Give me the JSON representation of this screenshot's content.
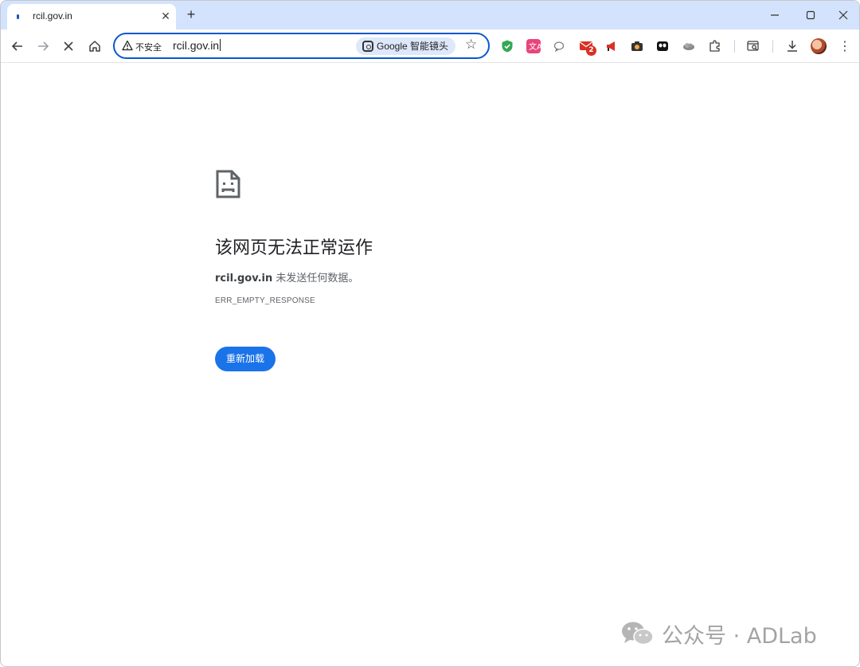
{
  "tab": {
    "title": "rcil.gov.in",
    "close_glyph": "✕",
    "new_tab_glyph": "+"
  },
  "window_controls": {
    "minimize": "—",
    "maximize": "☐",
    "close": "✕"
  },
  "toolbar": {
    "back_glyph": "←",
    "forward_glyph": "→",
    "stop_glyph": "✕",
    "home_glyph": "⌂"
  },
  "omnibox": {
    "security_label": "不安全",
    "url": "rcil.gov.in",
    "lens_label": "Google 智能镜头",
    "bookmark_glyph": "☆"
  },
  "extensions": {
    "icons": [
      "shield-check-icon",
      "translate-icon",
      "chat-bubble-icon",
      "mail-icon",
      "megaphone-icon",
      "camera-icon",
      "mask-icon",
      "cloud-icon",
      "puzzle-icon",
      "tab-search-icon",
      "download-icon"
    ],
    "mail_badge": "2",
    "menu_glyph": "⋮"
  },
  "error_page": {
    "title": "该网页无法正常运作",
    "host": "rcil.gov.in",
    "description": " 未发送任何数据。",
    "error_code": "ERR_EMPTY_RESPONSE",
    "reload_label": "重新加载"
  },
  "watermark": {
    "text": "公众号 · ADLab"
  },
  "colors": {
    "tabstrip_bg": "#d3e3fd",
    "omnibox_border": "#0b57d0",
    "reload_button": "#1a73e8",
    "badge_red": "#d93025"
  }
}
